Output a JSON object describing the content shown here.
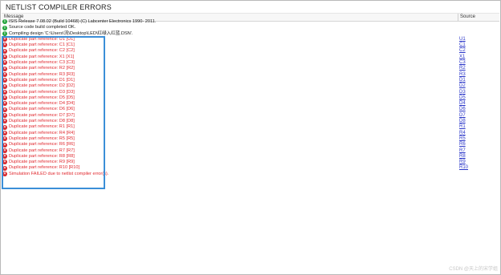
{
  "window": {
    "title": "NETLIST COMPILER ERRORS"
  },
  "header": {
    "message": "Message",
    "source": "Source"
  },
  "rows": [
    {
      "type": "info",
      "icon": "info-icon",
      "text": "ISIS Release 7.08.02 (Build 10468) (C) Labcenter Electronics 1990- 2011.",
      "source": ""
    },
    {
      "type": "info",
      "icon": "info-icon",
      "text": "Source code build completed OK.",
      "source": ""
    },
    {
      "type": "info",
      "icon": "info-icon",
      "text": "Compiling design 'C:\\Users\\流\\Desktop\\LED\\红绿入红蓝.DSN'.",
      "source": ""
    },
    {
      "type": "err",
      "icon": "error-icon",
      "text": "Duplicate part reference: U1 [U1]",
      "source": "U1"
    },
    {
      "type": "err",
      "icon": "error-icon",
      "text": "Duplicate part reference: C1 [C1]",
      "source": "C1"
    },
    {
      "type": "err",
      "icon": "error-icon",
      "text": "Duplicate part reference: C2 [C2]",
      "source": "C2"
    },
    {
      "type": "err",
      "icon": "error-icon",
      "text": "Duplicate part reference: X1 [X1]",
      "source": "X1"
    },
    {
      "type": "err",
      "icon": "error-icon",
      "text": "Duplicate part reference: C3 [C3]",
      "source": "C3"
    },
    {
      "type": "err",
      "icon": "error-icon",
      "text": "Duplicate part reference: R2 [R2]",
      "source": "R2"
    },
    {
      "type": "err",
      "icon": "error-icon",
      "text": "Duplicate part reference: R3 [R3]",
      "source": "R3"
    },
    {
      "type": "err",
      "icon": "error-icon",
      "text": "Duplicate part reference: D1 [D1]",
      "source": "D1"
    },
    {
      "type": "err",
      "icon": "error-icon",
      "text": "Duplicate part reference: D2 [D2]",
      "source": "D2"
    },
    {
      "type": "err",
      "icon": "error-icon",
      "text": "Duplicate part reference: D3 [D3]",
      "source": "D3"
    },
    {
      "type": "err",
      "icon": "error-icon",
      "text": "Duplicate part reference: D5 [D5]",
      "source": "D5"
    },
    {
      "type": "err",
      "icon": "error-icon",
      "text": "Duplicate part reference: D4 [D4]",
      "source": "D4"
    },
    {
      "type": "err",
      "icon": "error-icon",
      "text": "Duplicate part reference: D6 [D6]",
      "source": "D6"
    },
    {
      "type": "err",
      "icon": "error-icon",
      "text": "Duplicate part reference: D7 [D7]",
      "source": "D7"
    },
    {
      "type": "err",
      "icon": "error-icon",
      "text": "Duplicate part reference: D8 [D8]",
      "source": "D8"
    },
    {
      "type": "err",
      "icon": "error-icon",
      "text": "Duplicate part reference: R1 [R1]",
      "source": "R1"
    },
    {
      "type": "err",
      "icon": "error-icon",
      "text": "Duplicate part reference: R4 [R4]",
      "source": "R4"
    },
    {
      "type": "err",
      "icon": "error-icon",
      "text": "Duplicate part reference: R5 [R5]",
      "source": "R5"
    },
    {
      "type": "err",
      "icon": "error-icon",
      "text": "Duplicate part reference: R6 [R6]",
      "source": "R6"
    },
    {
      "type": "err",
      "icon": "error-icon",
      "text": "Duplicate part reference: R7 [R7]",
      "source": "R7"
    },
    {
      "type": "err",
      "icon": "error-icon",
      "text": "Duplicate part reference: R8 [R8]",
      "source": "R8"
    },
    {
      "type": "err",
      "icon": "error-icon",
      "text": "Duplicate part reference: R9 [R9]",
      "source": "R9"
    },
    {
      "type": "err",
      "icon": "error-icon",
      "text": "Duplicate part reference: R10 [R10]",
      "source": "R10"
    },
    {
      "type": "err",
      "icon": "error-icon",
      "text": "Simulation FAILED due to netlist compiler error(s).",
      "source": ""
    }
  ],
  "watermark": "CSDN @天上的宋学姐",
  "colors": {
    "error": "#e0282e",
    "info_icon": "#22a33a",
    "link": "#2a36c8",
    "highlight": "#3b8fd8"
  }
}
